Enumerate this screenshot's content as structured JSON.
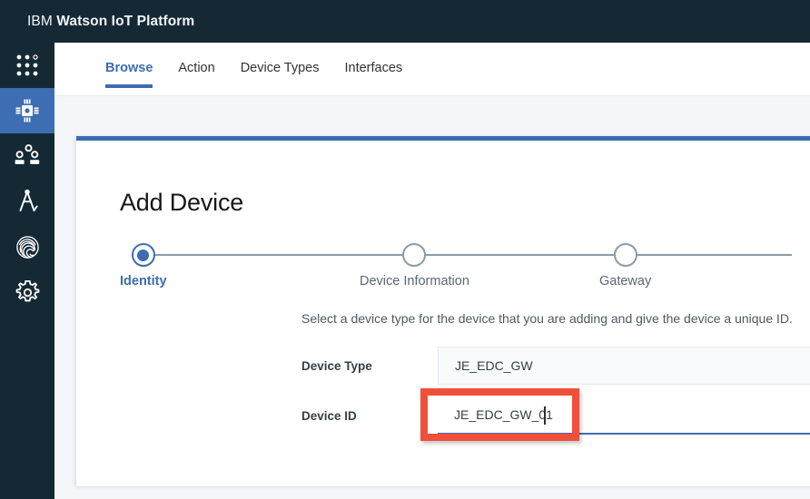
{
  "header": {
    "brand_light": "IBM",
    "brand_bold": "Watson IoT Platform"
  },
  "sidebar": {
    "items": [
      {
        "name": "app-switcher",
        "icon": "grid-dots-icon",
        "active": false
      },
      {
        "name": "devices",
        "icon": "chip-icon",
        "active": true
      },
      {
        "name": "members",
        "icon": "users-icon",
        "active": false
      },
      {
        "name": "boards",
        "icon": "compass-icon",
        "active": false
      },
      {
        "name": "security",
        "icon": "fingerprint-icon",
        "active": false
      },
      {
        "name": "settings",
        "icon": "gear-icon",
        "active": false
      }
    ]
  },
  "tabs": [
    {
      "label": "Browse",
      "active": true
    },
    {
      "label": "Action",
      "active": false
    },
    {
      "label": "Device Types",
      "active": false
    },
    {
      "label": "Interfaces",
      "active": false
    }
  ],
  "main": {
    "title": "Add Device",
    "helper_text": "Select a device type for the device that you are adding and give the device a unique ID.",
    "steps": [
      {
        "label": "Identity",
        "state": "active"
      },
      {
        "label": "Device Information",
        "state": "upcoming"
      },
      {
        "label": "Gateway",
        "state": "upcoming"
      }
    ],
    "fields": [
      {
        "label": "Device Type",
        "value": "JE_EDC_GW",
        "placeholder": "",
        "state": "readonly"
      },
      {
        "label": "Device ID",
        "value": "JE_EDC_GW_01",
        "placeholder": "",
        "state": "focused"
      }
    ]
  },
  "colors": {
    "header_bg": "#152935",
    "sidebar_bg": "#152935",
    "accent_blue": "#3d6db3",
    "annotation_red": "#f0503a",
    "page_bg": "#f4f6fa",
    "card_bg": "#ffffff"
  }
}
